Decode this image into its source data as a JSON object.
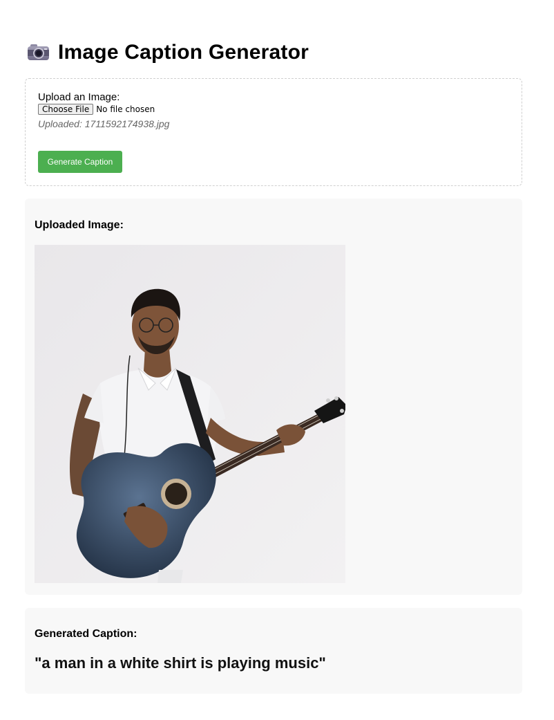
{
  "app": {
    "title": "Image Caption Generator",
    "title_icon": "camera-icon"
  },
  "upload": {
    "label": "Upload an Image:",
    "choose_file_label": "Choose File",
    "file_status": "No file chosen",
    "uploaded_note": "Uploaded: 1711592174938.jpg",
    "generate_button_label": "Generate Caption",
    "generate_button_color": "#4caf50"
  },
  "image_section": {
    "heading": "Uploaded Image:"
  },
  "caption_section": {
    "heading": "Generated Caption:",
    "caption": "\"a man in a white shirt is playing music\""
  }
}
